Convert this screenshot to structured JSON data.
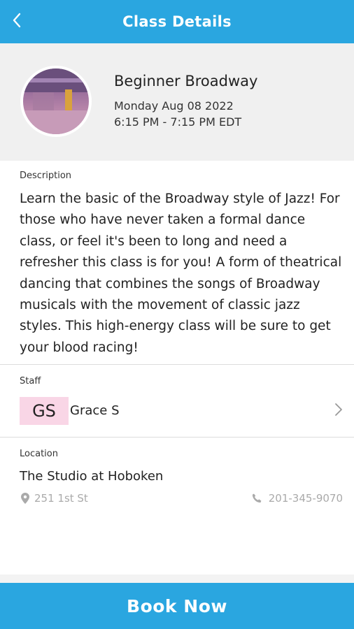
{
  "header": {
    "title": "Class Details"
  },
  "class": {
    "title": "Beginner Broadway",
    "date": "Monday Aug 08 2022",
    "time": "6:15 PM - 7:15 PM EDT"
  },
  "description": {
    "label": "Description",
    "text": "Learn the basic of the Broadway style of Jazz! For those who have never taken a formal dance class, or feel it's been to long and need a refresher this class is for you! A form of theatrical dancing that combines the songs of Broadway musicals with the movement of classic jazz styles. This high-energy class will be sure to get your blood racing!"
  },
  "staff": {
    "label": "Staff",
    "initials": "GS",
    "name": "Grace S"
  },
  "location": {
    "label": "Location",
    "name": "The Studio at Hoboken",
    "address": "251 1st St",
    "phone": "201-345-9070"
  },
  "footer": {
    "book_label": "Book Now"
  },
  "colors": {
    "accent": "#2aa6e0",
    "initials_bg": "#f9d6e6"
  },
  "icons": [
    "chevron-left-icon",
    "chevron-right-icon",
    "map-pin-icon",
    "phone-icon"
  ]
}
